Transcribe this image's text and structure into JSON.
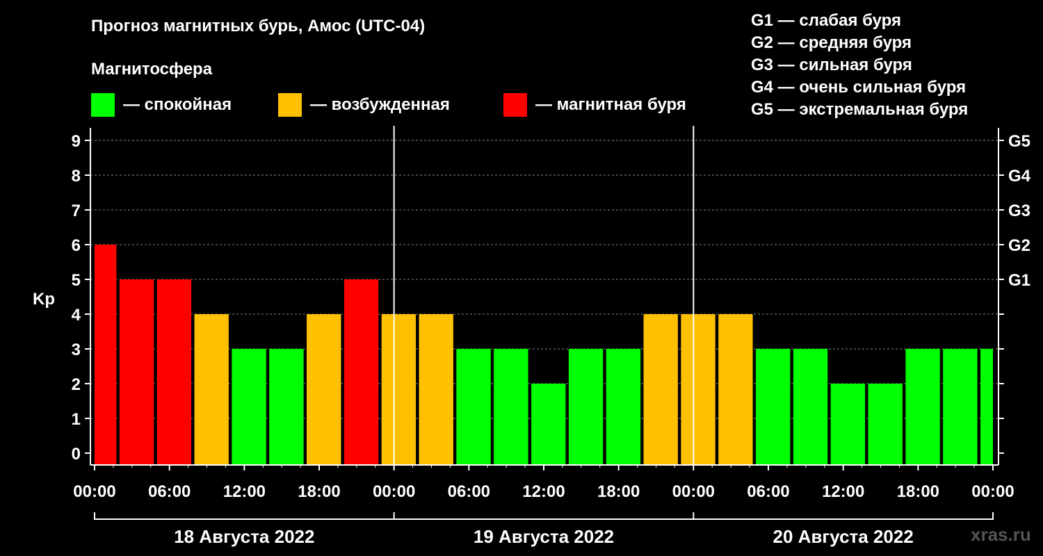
{
  "header": {
    "title": "Прогноз магнитных бурь, Амос (UTC-04)",
    "subtitle": "Магнитосфера"
  },
  "legend": [
    {
      "label": "— спокойная",
      "color": "#00FF00"
    },
    {
      "label": "— возбужденная",
      "color": "#FFC000"
    },
    {
      "label": "— магнитная буря",
      "color": "#FF0000"
    }
  ],
  "g_legend": [
    "G1 — слабая буря",
    "G2 — средняя буря",
    "G3 — сильная буря",
    "G4 — очень сильная буря",
    "G5 — экстремальная буря"
  ],
  "watermark": "xras.ru",
  "chart_data": {
    "type": "bar",
    "ylabel": "Kp",
    "ylim": [
      0,
      9
    ],
    "yticks": [
      "0",
      "1",
      "2",
      "3",
      "4",
      "5",
      "6",
      "7",
      "8",
      "9"
    ],
    "right_ticks": [
      {
        "kp": 5,
        "label": "G1"
      },
      {
        "kp": 6,
        "label": "G2"
      },
      {
        "kp": 7,
        "label": "G3"
      },
      {
        "kp": 8,
        "label": "G4"
      },
      {
        "kp": 9,
        "label": "G5"
      }
    ],
    "xtick_labels": [
      "00:00",
      "06:00",
      "12:00",
      "18:00",
      "00:00",
      "06:00",
      "12:00",
      "18:00",
      "00:00",
      "06:00",
      "12:00",
      "18:00",
      "00:00"
    ],
    "days": [
      "18 Августа 2022",
      "19 Августа 2022",
      "20 Августа 2022"
    ],
    "grid": true,
    "colors": {
      "quiet": "#00FF00",
      "active": "#FFC000",
      "storm": "#FF0000"
    },
    "bars": [
      {
        "start_hour": 0,
        "end_hour": 3.5,
        "kp": 6,
        "state": "storm"
      },
      {
        "start_hour": 4,
        "end_hour": 9.5,
        "kp": 5,
        "state": "storm"
      },
      {
        "start_hour": 10,
        "end_hour": 15.5,
        "kp": 5,
        "state": "storm"
      },
      {
        "start_hour": 16,
        "end_hour": 21.5,
        "kp": 4,
        "state": "active"
      },
      {
        "start_hour": 22,
        "end_hour": 27.5,
        "kp": 3,
        "state": "quiet"
      },
      {
        "start_hour": 28,
        "end_hour": 33.5,
        "kp": 3,
        "state": "quiet"
      },
      {
        "start_hour": 34,
        "end_hour": 39.5,
        "kp": 4,
        "state": "active"
      },
      {
        "start_hour": 40,
        "end_hour": 45.5,
        "kp": 5,
        "state": "storm"
      },
      {
        "start_hour": 46,
        "end_hour": 51.5,
        "kp": 4,
        "state": "active"
      },
      {
        "start_hour": 52,
        "end_hour": 57.5,
        "kp": 4,
        "state": "active"
      },
      {
        "start_hour": 58,
        "end_hour": 63.5,
        "kp": 3,
        "state": "quiet"
      },
      {
        "start_hour": 64,
        "end_hour": 69.5,
        "kp": 3,
        "state": "quiet"
      },
      {
        "start_hour": 70,
        "end_hour": 75.5,
        "kp": 2,
        "state": "quiet"
      },
      {
        "start_hour": 76,
        "end_hour": 81.5,
        "kp": 3,
        "state": "quiet"
      },
      {
        "start_hour": 82,
        "end_hour": 87.5,
        "kp": 3,
        "state": "quiet"
      },
      {
        "start_hour": 88,
        "end_hour": 93.5,
        "kp": 4,
        "state": "active"
      },
      {
        "start_hour": 94,
        "end_hour": 99.5,
        "kp": 4,
        "state": "active"
      },
      {
        "start_hour": 100,
        "end_hour": 105.5,
        "kp": 4,
        "state": "active"
      },
      {
        "start_hour": 106,
        "end_hour": 111.5,
        "kp": 3,
        "state": "quiet"
      },
      {
        "start_hour": 112,
        "end_hour": 117.5,
        "kp": 3,
        "state": "quiet"
      },
      {
        "start_hour": 118,
        "end_hour": 123.5,
        "kp": 2,
        "state": "quiet"
      },
      {
        "start_hour": 124,
        "end_hour": 129.5,
        "kp": 2,
        "state": "quiet"
      },
      {
        "start_hour": 130,
        "end_hour": 135.5,
        "kp": 3,
        "state": "quiet"
      },
      {
        "start_hour": 136,
        "end_hour": 141.5,
        "kp": 3,
        "state": "quiet"
      },
      {
        "start_hour": 142,
        "end_hour": 144,
        "kp": 3,
        "state": "quiet"
      }
    ]
  }
}
